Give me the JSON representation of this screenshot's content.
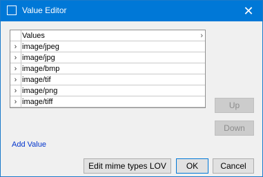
{
  "window": {
    "title": "Value Editor",
    "close_glyph": "✕"
  },
  "grid": {
    "header": "Values",
    "rows": [
      "image/jpeg",
      "image/jpg",
      "image/bmp",
      "image/tif",
      "image/png",
      "image/tiff"
    ]
  },
  "buttons": {
    "up": "Up",
    "down": "Down",
    "add_value": "Add Value",
    "edit_lov": "Edit mime types LOV",
    "ok": "OK",
    "cancel": "Cancel"
  },
  "icons": {
    "row_expander": "chevron-right-icon",
    "app": "window-icon",
    "close": "close-icon"
  },
  "colors": {
    "titlebar": "#0078d7",
    "link": "#0033cc"
  }
}
